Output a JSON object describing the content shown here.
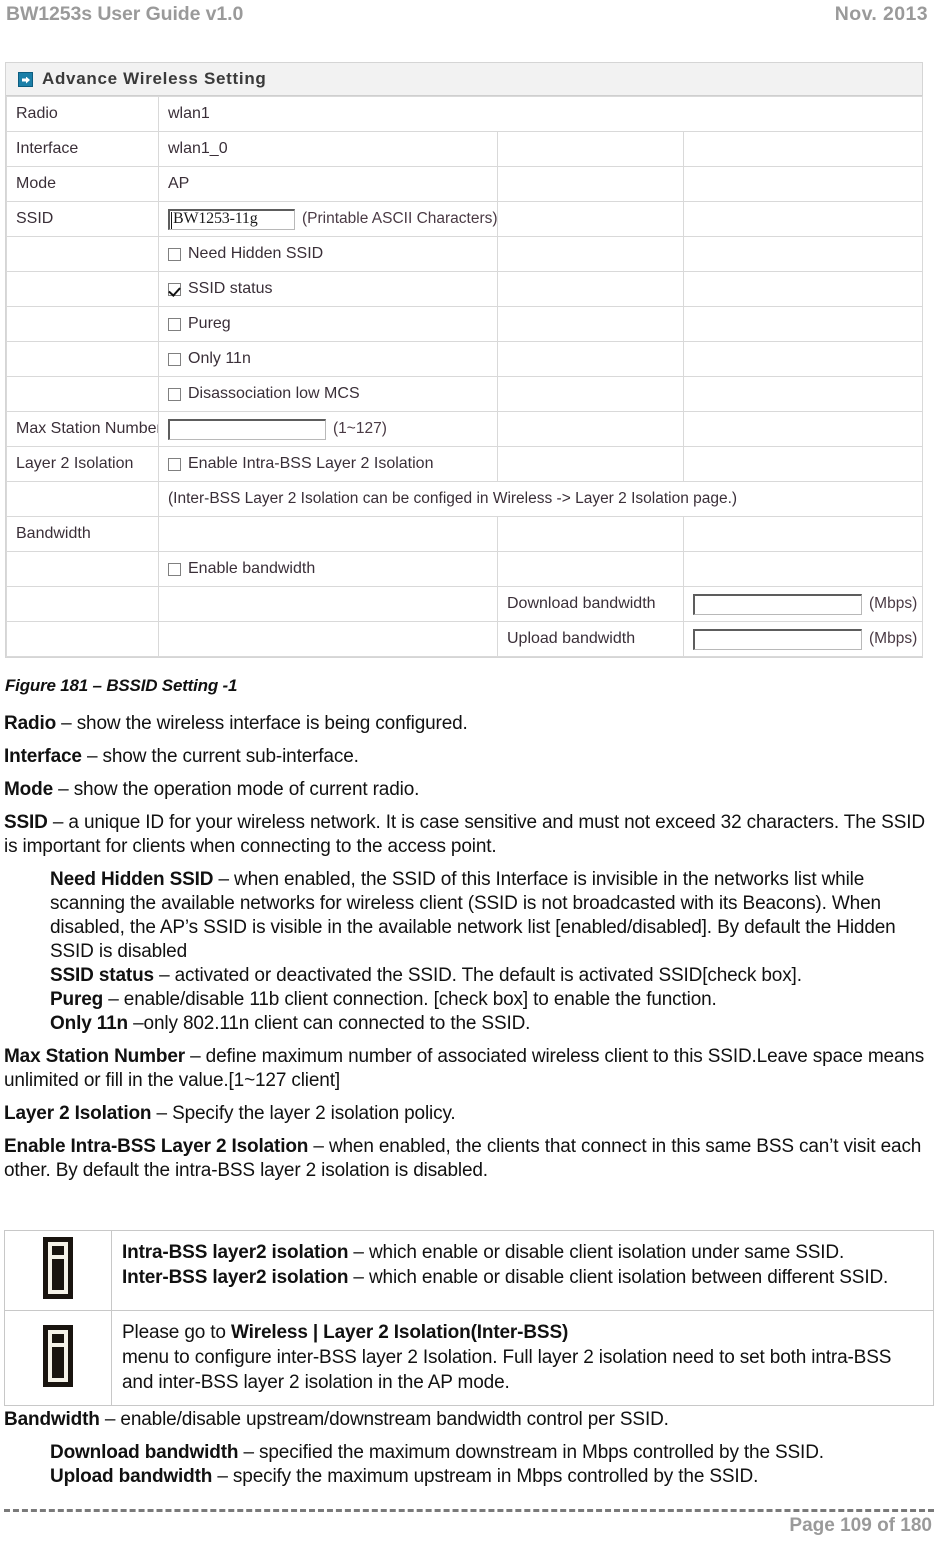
{
  "header": {
    "left": "BW1253s User Guide v1.0",
    "right": "Nov.  2013"
  },
  "screenshot": {
    "title": "Advance Wireless Setting",
    "title_icon": "arrow-square-icon",
    "rows": [
      {
        "label": "Radio",
        "value": "wlan1"
      },
      {
        "label": "Interface",
        "value": "wlan1_0"
      },
      {
        "label": "Mode",
        "value": "AP"
      },
      {
        "label": "SSID",
        "input_value": "BW1253-11g",
        "hint": "(Printable ASCII Characters)"
      },
      {
        "label": "",
        "checkbox": "Need Hidden SSID",
        "checked": false
      },
      {
        "label": "",
        "checkbox": "SSID status",
        "checked": true
      },
      {
        "label": "",
        "checkbox": "Pureg",
        "checked": false
      },
      {
        "label": "",
        "checkbox": "Only 11n",
        "checked": false
      },
      {
        "label": "",
        "checkbox": "Disassociation low MCS",
        "checked": false
      },
      {
        "label": "Max Station Number",
        "input_value": "",
        "hint": "(1~127)"
      },
      {
        "label": "Layer 2 Isolation",
        "checkbox": "Enable Intra-BSS Layer 2 Isolation",
        "checked": false
      },
      {
        "label": "",
        "note": "(Inter-BSS Layer 2 Isolation can be configed in Wireless -> Layer 2 Isolation page.)"
      },
      {
        "label": "Bandwidth",
        "value": ""
      },
      {
        "label": "",
        "checkbox": "Enable bandwidth",
        "checked": false
      },
      {
        "label": "",
        "col3": "Download bandwidth",
        "input_value": "",
        "unit": "(Mbps)"
      },
      {
        "label": "",
        "col3": "Upload bandwidth",
        "input_value": "",
        "unit": "(Mbps)"
      }
    ]
  },
  "figure_caption": "Figure 181 –  BSSID Setting -1",
  "body": {
    "radio": {
      "term": "Radio",
      "text": " – show the wireless interface is being configured."
    },
    "interface": {
      "term": "Interface",
      "text": " – show the current sub-interface."
    },
    "mode": {
      "term": "Mode",
      "text": " – show the operation mode of current radio."
    },
    "ssid": {
      "term": "SSID",
      "text": " – a unique ID for your wireless network. It is case sensitive and must not exceed 32 characters. The SSID is important for clients when connecting to the access point."
    },
    "need_hidden_ssid": {
      "term": "Need Hidden SSID",
      "text": " – when enabled, the SSID of this Interface is invisible in the networks list while scanning the available networks for wireless client (SSID is not broadcasted with its Beacons). When disabled, the AP’s SSID is visible in the available network list [enabled/disabled]. By default the Hidden SSID is disabled"
    },
    "ssid_status": {
      "term": "SSID status",
      "text": " – activated or deactivated the SSID. The default is activated SSID[check box]."
    },
    "pureg": {
      "term": "Pureg",
      "text": " – enable/disable 11b client connection. [check box] to enable the function."
    },
    "only11n": {
      "term": "Only 11n",
      "text": " –only 802.11n client can connected to the SSID."
    },
    "max_station_number": {
      "term": "Max Station Number",
      "text": " – define maximum number of associated wireless client to this SSID.Leave space means unlimited or fill in the value.[1~127 client]"
    },
    "layer2_isolation": {
      "term": "Layer 2 Isolation",
      "text": " – Specify the layer 2 isolation policy."
    },
    "enable_intra_bss": {
      "term": "Enable Intra-BSS Layer 2 Isolation",
      "text": " – when enabled, the clients that connect in this same BSS can’t visit each other. By default the intra-BSS layer 2 isolation is disabled."
    },
    "bandwidth": {
      "term": "Bandwidth",
      "text": " – enable/disable upstream/downstream bandwidth control per SSID."
    },
    "download_bandwidth": {
      "term": "Download bandwidth",
      "text": " – specified the maximum downstream in Mbps controlled by the SSID."
    },
    "upload_bandwidth": {
      "term": "Upload bandwidth",
      "text": " – specify the maximum upstream in Mbps controlled by the SSID."
    }
  },
  "notes": [
    {
      "icon": "info-icon",
      "lines": [
        {
          "term": "Intra-BSS layer2 isolation",
          "text": " – which enable or disable client isolation under same SSID."
        },
        {
          "term": "Inter-BSS layer2 isolation",
          "text": " – which enable or disable client isolation between different SSID."
        }
      ]
    },
    {
      "icon": "info-icon",
      "lines": [
        {
          "pre": "Please go to ",
          "term": "Wireless | Layer 2 Isolation(Inter-BSS)",
          "text": ""
        },
        {
          "term": "",
          "text": "menu to configure inter-BSS layer 2 Isolation. Full layer 2 isolation need to set both intra-BSS and inter-BSS layer 2 isolation in the AP mode."
        }
      ]
    }
  ],
  "footer": {
    "page_text": "Page 109 of 180"
  }
}
